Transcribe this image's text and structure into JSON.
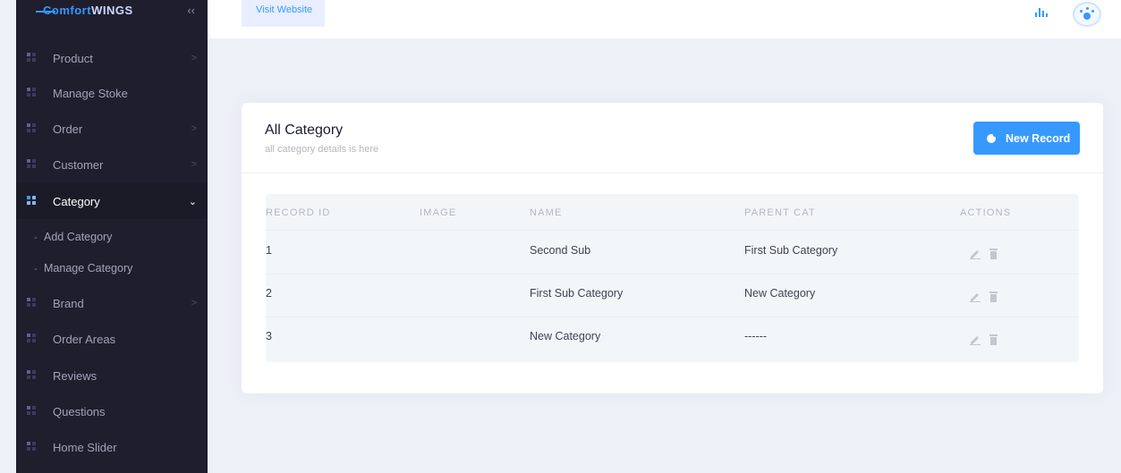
{
  "brand": {
    "logo_text": "ComfortWings",
    "toggle_icon": "double-chevron-left-icon"
  },
  "header": {
    "visit_label": "Visit Website"
  },
  "sidebar": {
    "items": [
      {
        "label": "Product",
        "arrow": ">"
      },
      {
        "label": "Manage Stoke",
        "arrow": ""
      },
      {
        "label": "Order",
        "arrow": ">"
      },
      {
        "label": "Customer",
        "arrow": ">"
      },
      {
        "label": "Category",
        "arrow": "⌄"
      },
      {
        "label": "Brand",
        "arrow": ">"
      },
      {
        "label": "Order Areas",
        "arrow": ""
      },
      {
        "label": "Reviews",
        "arrow": ""
      },
      {
        "label": "Questions",
        "arrow": ""
      },
      {
        "label": "Home Slider",
        "arrow": ""
      }
    ],
    "sub_items": [
      {
        "label": "Add Category"
      },
      {
        "label": "Manage Category"
      }
    ],
    "sub_dash": "-"
  },
  "card": {
    "title": "All Category",
    "subtitle": "all category details is here",
    "new_button_label": "New Record"
  },
  "table": {
    "headers": [
      "RECORD ID",
      "IMAGE",
      "NAME",
      "PARENT CAT",
      "ACTIONS"
    ],
    "rows": [
      {
        "id": "1",
        "image": "",
        "name": "Second Sub",
        "parent": "First Sub Category"
      },
      {
        "id": "2",
        "image": "",
        "name": "First Sub Category",
        "parent": "New Category"
      },
      {
        "id": "3",
        "image": "",
        "name": "New Category",
        "parent": "------"
      }
    ]
  },
  "colors": {
    "accent": "#3699ff",
    "sidebar_bg": "#1e1e2d",
    "page_bg": "#eef0f8"
  }
}
